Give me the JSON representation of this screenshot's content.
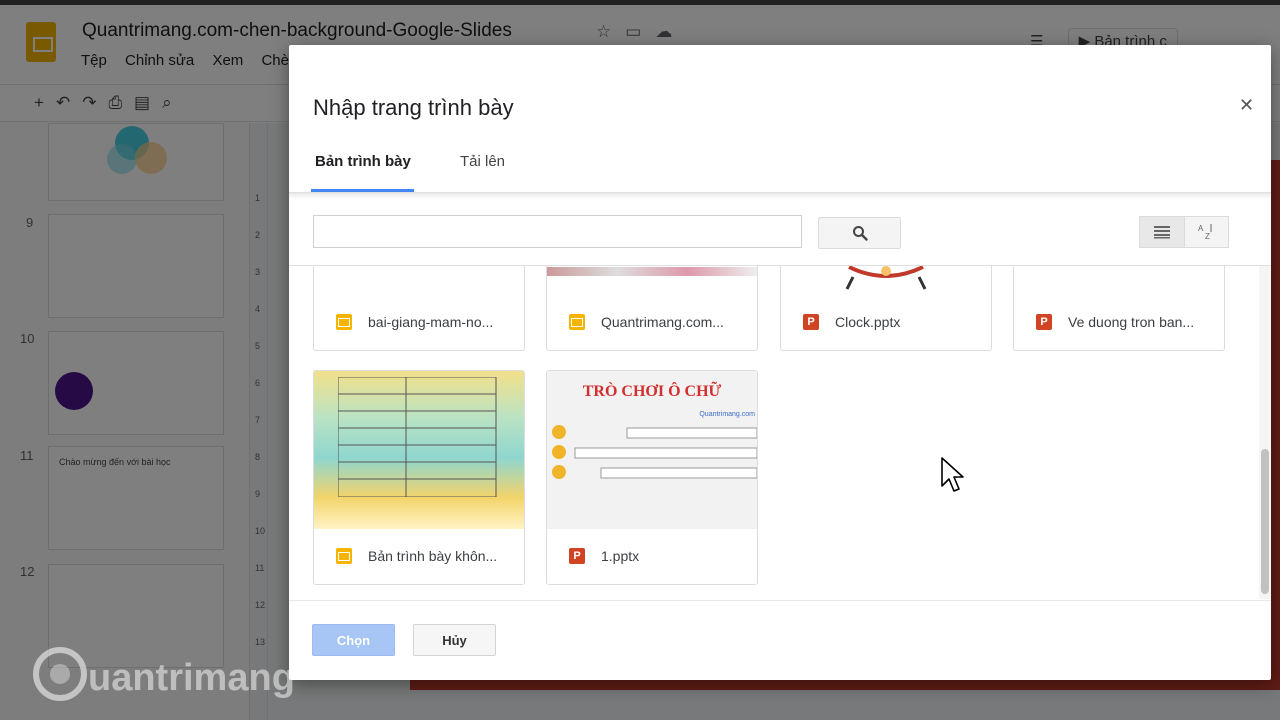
{
  "app": {
    "doc_title": "Quantrimang.com-chen-background-Google-Slides",
    "menu": [
      "Tệp",
      "Chỉnh sửa",
      "Xem",
      "Chè"
    ],
    "present_label": "Bản trình c",
    "slide_numbers": [
      "9",
      "10",
      "11",
      "12"
    ],
    "slide_thumb_text": [
      "Chào mừng đến với bài học"
    ],
    "ruler_numbers": [
      "1",
      "2",
      "3",
      "4",
      "5",
      "6",
      "7",
      "8",
      "9",
      "10",
      "11",
      "12",
      "13"
    ]
  },
  "dialog": {
    "title": "Nhập trang trình bày",
    "close_icon": "close-icon",
    "tabs": [
      {
        "label": "Bản trình bày",
        "active": true
      },
      {
        "label": "Tải lên",
        "active": false
      }
    ],
    "search": {
      "value": "",
      "placeholder": ""
    },
    "files": [
      {
        "name": "bai-giang-mam-no...",
        "type": "slides"
      },
      {
        "name": "Quantrimang.com...",
        "type": "slides"
      },
      {
        "name": "Clock.pptx",
        "type": "pptx"
      },
      {
        "name": "Ve duong tron ban...",
        "type": "pptx"
      },
      {
        "name": "Bản trình bày khôn...",
        "type": "slides"
      },
      {
        "name": "1.pptx",
        "type": "pptx"
      }
    ],
    "thumb_text": {
      "game_title": "TRÒ CHƠI Ô CHỮ",
      "game_subtitle": "Quantrimang.com"
    },
    "buttons": {
      "choose": "Chọn",
      "cancel": "Hủy"
    }
  },
  "colors": {
    "accent": "#4285f4",
    "slides_icon": "#f4b400",
    "pptx_icon": "#d04423",
    "choose_disabled": "#a7c5f5"
  },
  "watermark": "uantrimang"
}
